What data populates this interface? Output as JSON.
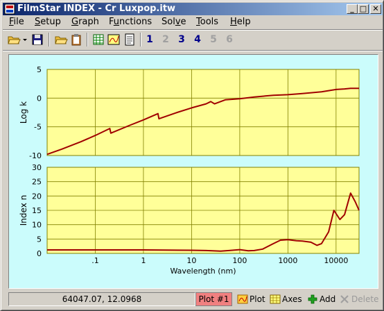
{
  "window": {
    "title": "FilmStar INDEX - Cr Luxpop.itw",
    "minimize_glyph": "_",
    "maximize_glyph": "□",
    "close_glyph": "✕"
  },
  "menu": {
    "items": [
      {
        "label": "File",
        "accel": "F"
      },
      {
        "label": "Setup",
        "accel": "S"
      },
      {
        "label": "Graph",
        "accel": "G"
      },
      {
        "label": "Functions",
        "accel": "u"
      },
      {
        "label": "Solve",
        "accel": "v"
      },
      {
        "label": "Tools",
        "accel": "T"
      },
      {
        "label": "Help",
        "accel": "H"
      }
    ]
  },
  "toolbar": {
    "numbers": [
      "1",
      "2",
      "3",
      "4",
      "5",
      "6"
    ],
    "number_states": [
      "enabled",
      "disabled",
      "enabled",
      "enabled",
      "disabled",
      "disabled"
    ],
    "colors": {
      "enabled": "#00008b",
      "disabled": "#a0a0a0"
    }
  },
  "chart_data": [
    {
      "type": "line",
      "title": "",
      "xlabel": "",
      "ylabel": "Log k",
      "xscale": "log",
      "xlim": [
        0.01,
        30000
      ],
      "ylim": [
        -10,
        5
      ],
      "yticks": [
        "5",
        "0",
        "-5",
        "-10"
      ],
      "grid": true,
      "line_color": "#a00000",
      "series": [
        {
          "x": [
            0.01,
            0.02,
            0.05,
            0.1,
            0.2,
            0.21,
            0.5,
            1,
            2,
            2.1,
            5,
            10,
            20,
            25,
            30,
            50,
            100,
            200,
            500,
            1000,
            2000,
            5000,
            10000,
            15000,
            20000,
            30000
          ],
          "y": [
            -9.8,
            -8.9,
            -7.6,
            -6.5,
            -5.3,
            -6.1,
            -4.8,
            -3.8,
            -2.7,
            -3.6,
            -2.5,
            -1.7,
            -1.0,
            -0.6,
            -1.0,
            -0.3,
            -0.1,
            0.2,
            0.5,
            0.6,
            0.8,
            1.1,
            1.5,
            1.6,
            1.7,
            1.7
          ]
        }
      ]
    },
    {
      "type": "line",
      "title": "",
      "xlabel": "Wavelength (nm)",
      "ylabel": "Index n",
      "xscale": "log",
      "xlim": [
        0.01,
        30000
      ],
      "ylim": [
        0,
        30
      ],
      "yticks": [
        "30",
        "25",
        "20",
        "15",
        "10",
        "5",
        "0"
      ],
      "xticks": [
        ".1",
        "1",
        "10",
        "100",
        "1000",
        "10000"
      ],
      "grid": true,
      "line_color": "#a00000",
      "series": [
        {
          "x": [
            0.01,
            0.1,
            1,
            10,
            20,
            40,
            60,
            100,
            150,
            200,
            300,
            500,
            700,
            1000,
            1500,
            2000,
            3000,
            4000,
            5000,
            7000,
            9000,
            12000,
            15000,
            20000,
            25000,
            30000
          ],
          "y": [
            1.2,
            1.2,
            1.2,
            1.1,
            1.0,
            0.8,
            1.0,
            1.3,
            0.9,
            1.0,
            1.5,
            3.4,
            4.6,
            4.8,
            4.4,
            4.3,
            3.9,
            2.8,
            3.4,
            7.5,
            15.0,
            11.8,
            13.5,
            21.0,
            18.0,
            15.0
          ]
        }
      ]
    }
  ],
  "status": {
    "coordinates": "64047.07, 12.0968",
    "plot_badge": "Plot #1",
    "plot_button": "Plot",
    "axes_button": "Axes",
    "add_button": "Add",
    "delete_button": "Delete"
  }
}
